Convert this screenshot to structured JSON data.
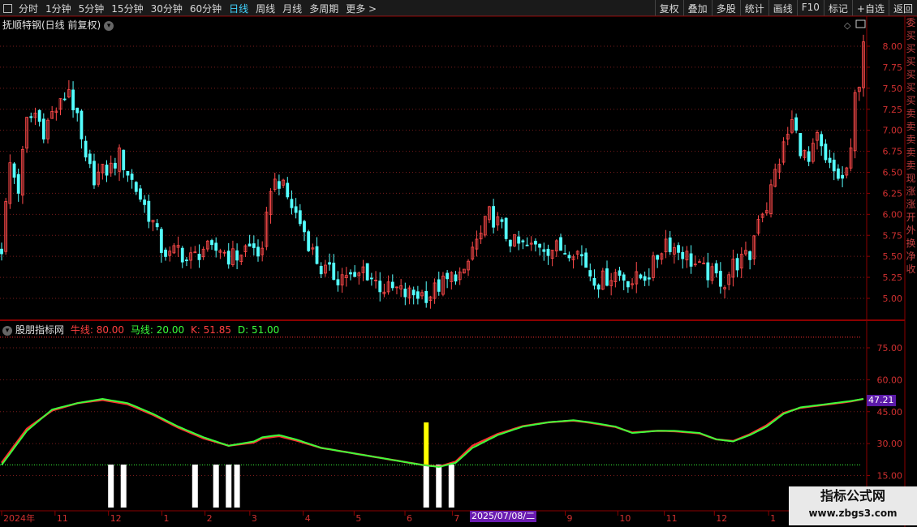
{
  "toolbar": {
    "left_items": [
      {
        "label": "分时",
        "active": false
      },
      {
        "label": "1分钟",
        "active": false
      },
      {
        "label": "5分钟",
        "active": false
      },
      {
        "label": "15分钟",
        "active": false
      },
      {
        "label": "30分钟",
        "active": false
      },
      {
        "label": "60分钟",
        "active": false
      },
      {
        "label": "日线",
        "active": true
      },
      {
        "label": "周线",
        "active": false
      },
      {
        "label": "月线",
        "active": false
      },
      {
        "label": "多周期",
        "active": false
      },
      {
        "label": "更多 >",
        "active": false
      }
    ],
    "right_items": [
      "复权",
      "叠加",
      "多股",
      "统计",
      "画线",
      "F10",
      "标记",
      "+自选",
      "返回"
    ]
  },
  "main_panel": {
    "title": "抚顺特钢(日线 前复权)"
  },
  "indicator_panel": {
    "name": "股朋指标网",
    "bull_line": "牛线: 80.00",
    "horse_line": "马线: 20.00",
    "k_value": "K: 51.85",
    "d_value": "D: 51.00",
    "current_value": "47.21"
  },
  "side_strip_text": [
    "委",
    "买",
    "买",
    "买",
    "买",
    "买",
    "买",
    "卖",
    "卖",
    "卖",
    "卖",
    "卖",
    "现",
    "涨",
    "涨",
    "开",
    "外",
    "换",
    "净",
    "收"
  ],
  "x_axis_labels": [
    {
      "label": "2024年",
      "pos": 0
    },
    {
      "label": "11",
      "pos": 0.062
    },
    {
      "label": "12",
      "pos": 0.124
    },
    {
      "label": "1",
      "pos": 0.186
    },
    {
      "label": "2",
      "pos": 0.236
    },
    {
      "label": "3",
      "pos": 0.288
    },
    {
      "label": "4",
      "pos": 0.35
    },
    {
      "label": "5",
      "pos": 0.409
    },
    {
      "label": "6",
      "pos": 0.468
    },
    {
      "label": "7",
      "pos": 0.523
    },
    {
      "label": "9",
      "pos": 0.654
    },
    {
      "label": "10",
      "pos": 0.715
    },
    {
      "label": "11",
      "pos": 0.769
    },
    {
      "label": "12",
      "pos": 0.827
    },
    {
      "label": "1",
      "pos": 0.89
    }
  ],
  "date_tag": "2025/07/08/二",
  "watermark": {
    "title": "指标公式网",
    "url": "www.zbgs3.com"
  },
  "colors": {
    "up": "#ff4a4a",
    "down": "#54ffff",
    "k_line": "#3bff3b",
    "d_line": "#ff3030",
    "axis": "#8b0000",
    "grid": "#7a1c1c",
    "highlight": "#ffff00"
  },
  "chart_data": [
    {
      "type": "candlestick",
      "title": "抚顺特钢(日线 前复权)",
      "ylim": [
        4.85,
        8.25
      ],
      "y_ticks": [
        5.0,
        5.25,
        5.5,
        5.75,
        6.0,
        6.25,
        6.5,
        6.75,
        7.0,
        7.25,
        7.5,
        7.75,
        8.0
      ],
      "close_path": [
        [
          0,
          5.6
        ],
        [
          2,
          6.6
        ],
        [
          4,
          6.3
        ],
        [
          6,
          7.1
        ],
        [
          8,
          7.2
        ],
        [
          10,
          7.0
        ],
        [
          12,
          7.2
        ],
        [
          14,
          7.3
        ],
        [
          16,
          7.5
        ],
        [
          18,
          7.1
        ],
        [
          20,
          6.6
        ],
        [
          22,
          6.45
        ],
        [
          24,
          6.5
        ],
        [
          26,
          6.55
        ],
        [
          28,
          6.7
        ],
        [
          30,
          6.5
        ],
        [
          32,
          6.3
        ],
        [
          34,
          6.1
        ],
        [
          36,
          5.9
        ],
        [
          38,
          5.6
        ],
        [
          40,
          5.5
        ],
        [
          42,
          5.6
        ],
        [
          44,
          5.45
        ],
        [
          46,
          5.5
        ],
        [
          48,
          5.6
        ],
        [
          50,
          5.55
        ],
        [
          52,
          5.6
        ],
        [
          54,
          5.5
        ],
        [
          56,
          5.5
        ],
        [
          58,
          5.6
        ],
        [
          60,
          5.6
        ],
        [
          62,
          5.5
        ],
        [
          64,
          6.35
        ],
        [
          66,
          6.4
        ],
        [
          68,
          6.2
        ],
        [
          70,
          6.0
        ],
        [
          72,
          5.8
        ],
        [
          74,
          5.55
        ],
        [
          76,
          5.35
        ],
        [
          78,
          5.3
        ],
        [
          80,
          5.25
        ],
        [
          82,
          5.3
        ],
        [
          84,
          5.2
        ],
        [
          86,
          5.35
        ],
        [
          88,
          5.25
        ],
        [
          90,
          5.15
        ],
        [
          92,
          5.1
        ],
        [
          94,
          5.1
        ],
        [
          96,
          5.05
        ],
        [
          98,
          5.05
        ],
        [
          100,
          5.05
        ],
        [
          102,
          5.05
        ],
        [
          104,
          5.15
        ],
        [
          106,
          5.2
        ],
        [
          108,
          5.3
        ],
        [
          110,
          5.25
        ],
        [
          112,
          5.6
        ],
        [
          114,
          5.75
        ],
        [
          116,
          6.0
        ],
        [
          118,
          5.9
        ],
        [
          120,
          5.75
        ],
        [
          122,
          5.65
        ],
        [
          124,
          5.62
        ],
        [
          126,
          5.6
        ],
        [
          128,
          5.65
        ],
        [
          130,
          5.6
        ],
        [
          132,
          5.6
        ],
        [
          134,
          5.58
        ],
        [
          136,
          5.6
        ],
        [
          138,
          5.5
        ],
        [
          140,
          5.3
        ],
        [
          142,
          5.2
        ],
        [
          144,
          5.25
        ],
        [
          146,
          5.3
        ],
        [
          148,
          5.25
        ],
        [
          150,
          5.2
        ],
        [
          152,
          5.25
        ],
        [
          154,
          5.3
        ],
        [
          156,
          5.5
        ],
        [
          158,
          5.7
        ],
        [
          160,
          5.6
        ],
        [
          162,
          5.55
        ],
        [
          164,
          5.45
        ],
        [
          166,
          5.35
        ],
        [
          168,
          5.3
        ],
        [
          170,
          5.25
        ],
        [
          172,
          5.2
        ],
        [
          174,
          5.4
        ],
        [
          176,
          5.45
        ],
        [
          178,
          5.5
        ],
        [
          180,
          6.0
        ],
        [
          182,
          6.1
        ],
        [
          184,
          6.5
        ],
        [
          186,
          6.8
        ],
        [
          188,
          7.1
        ],
        [
          190,
          6.8
        ],
        [
          192,
          6.6
        ],
        [
          194,
          6.9
        ],
        [
          196,
          6.6
        ],
        [
          198,
          6.5
        ],
        [
          200,
          6.4
        ],
        [
          202,
          6.7
        ],
        [
          203,
          7.4
        ],
        [
          204,
          7.6
        ],
        [
          205,
          8.1
        ]
      ]
    },
    {
      "type": "line",
      "title": "股朋指标网",
      "ylim": [
        7.5,
        84
      ],
      "y_ticks": [
        15.0,
        30.0,
        45.0,
        60.0,
        75.0
      ],
      "reference_lines": [
        {
          "name": "牛线",
          "value": 80.0
        },
        {
          "name": "马线",
          "value": 20.0
        }
      ],
      "series": [
        {
          "name": "K",
          "x": [
            0,
            6,
            12,
            18,
            24,
            30,
            36,
            42,
            48,
            54,
            60,
            62,
            66,
            70,
            76,
            82,
            88,
            94,
            100,
            104,
            108,
            112,
            118,
            124,
            130,
            136,
            140,
            146,
            150,
            156,
            160,
            166,
            170,
            174,
            178,
            182,
            186,
            190,
            194,
            198,
            202,
            205
          ],
          "values": [
            20,
            36,
            46,
            49,
            51,
            49,
            44,
            38,
            33,
            29,
            31,
            33,
            34,
            32,
            28,
            26,
            24,
            22,
            20,
            19,
            21,
            28,
            34,
            38,
            40,
            41,
            40,
            38,
            35,
            36,
            36,
            35,
            32,
            31,
            34,
            38,
            44,
            47,
            48,
            49,
            50,
            51
          ]
        },
        {
          "name": "D",
          "x": [
            0,
            6,
            12,
            18,
            24,
            30,
            36,
            42,
            48,
            54,
            60,
            62,
            66,
            70,
            76,
            82,
            88,
            94,
            100,
            104,
            108,
            112,
            118,
            124,
            130,
            136,
            140,
            146,
            150,
            156,
            160,
            166,
            170,
            174,
            178,
            182,
            186,
            190,
            194,
            198,
            202,
            205
          ],
          "values": [
            21,
            37,
            45.5,
            49,
            50.5,
            48.5,
            43.5,
            37.5,
            32.5,
            29,
            30.5,
            32.5,
            33.5,
            31.5,
            28,
            26,
            24,
            22,
            20,
            19.2,
            21.5,
            29,
            34.5,
            38.2,
            40,
            40.8,
            39.8,
            37.8,
            35.2,
            36,
            35.8,
            34.8,
            32,
            31.2,
            34.4,
            38.6,
            44.4,
            46.8,
            47.8,
            48.8,
            49.8,
            51
          ]
        }
      ],
      "signals": [
        {
          "x": 26,
          "kind": "white"
        },
        {
          "x": 29,
          "kind": "white"
        },
        {
          "x": 46,
          "kind": "white"
        },
        {
          "x": 51,
          "kind": "white"
        },
        {
          "x": 54,
          "kind": "white"
        },
        {
          "x": 56,
          "kind": "white"
        },
        {
          "x": 101,
          "kind": "white"
        },
        {
          "x": 104,
          "kind": "white"
        },
        {
          "x": 107,
          "kind": "white"
        },
        {
          "x": 101,
          "kind": "yellow"
        }
      ]
    }
  ]
}
